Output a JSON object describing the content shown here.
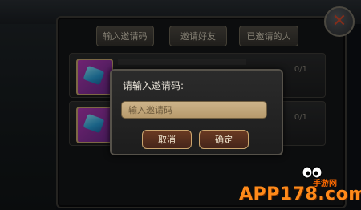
{
  "tabs": [
    {
      "label": "输入邀请码"
    },
    {
      "label": "邀请好友"
    },
    {
      "label": "已邀请的人"
    }
  ],
  "rows": [
    {
      "count": "0/1"
    },
    {
      "count": "0/1"
    }
  ],
  "dialog": {
    "title": "请输入邀请码:",
    "placeholder": "输入邀请码",
    "cancel_label": "取消",
    "confirm_label": "确定"
  },
  "watermark": {
    "text": "APP178.com",
    "subtitle": "手游网"
  },
  "colors": {
    "accent": "#ff8a1a",
    "button": "#6a3a22",
    "input": "#cdb48a"
  },
  "icons": [
    "close-icon",
    "gem-icon",
    "watermark-face-icon"
  ]
}
